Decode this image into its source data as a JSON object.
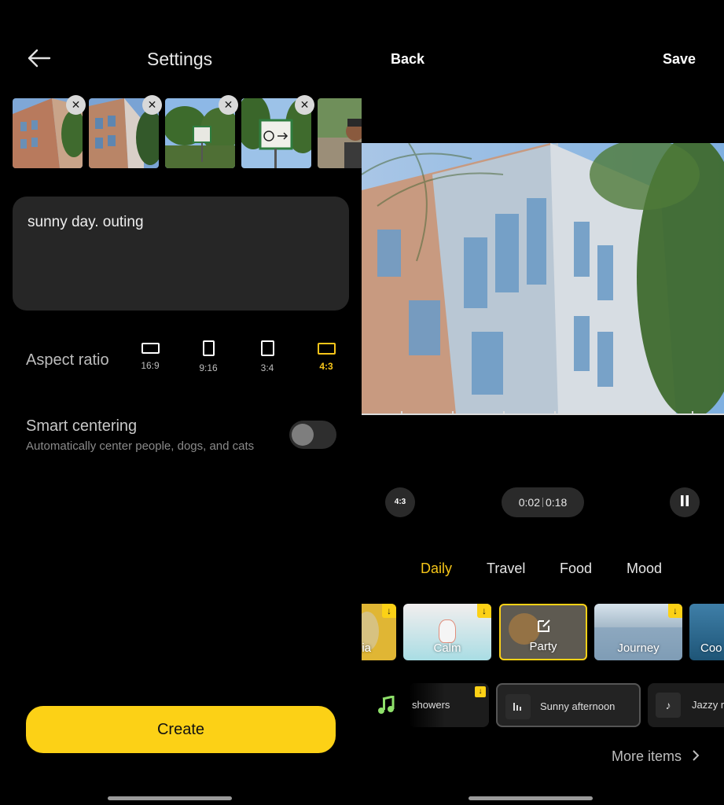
{
  "left": {
    "header": {
      "title": "Settings"
    },
    "thumbnails": [
      {
        "alt": "building photo 1"
      },
      {
        "alt": "building photo 2"
      },
      {
        "alt": "sign photo 1"
      },
      {
        "alt": "sign photo 2"
      },
      {
        "alt": "selfie photo"
      }
    ],
    "caption": {
      "text": "sunny day. outing"
    },
    "aspect_ratio": {
      "label": "Aspect ratio",
      "options": [
        {
          "label": "16:9",
          "selected": false
        },
        {
          "label": "9:16",
          "selected": false
        },
        {
          "label": "3:4",
          "selected": false
        },
        {
          "label": "4:3",
          "selected": true
        }
      ]
    },
    "smart_centering": {
      "title": "Smart centering",
      "description": "Automatically center people, dogs, and cats",
      "enabled": false
    },
    "create_label": "Create"
  },
  "right": {
    "header": {
      "back_label": "Back",
      "save_label": "Save"
    },
    "controls": {
      "aspect_badge": "4:3",
      "time_current": "0:02",
      "time_total": "0:18",
      "pause_icon": "pause-icon"
    },
    "categories": [
      {
        "label": "Daily",
        "selected": true
      },
      {
        "label": "Travel",
        "selected": false
      },
      {
        "label": "Food",
        "selected": false
      },
      {
        "label": "Mood",
        "selected": false
      }
    ],
    "styles": [
      {
        "name": "gia",
        "download": true
      },
      {
        "name": "Calm",
        "download": true
      },
      {
        "name": "Party",
        "selected": true
      },
      {
        "name": "Journey",
        "download": true
      },
      {
        "name": "Coo"
      }
    ],
    "music": [
      {
        "name": "showers",
        "download": true
      },
      {
        "name": "Sunny afternoon",
        "selected": true
      },
      {
        "name": "Jazzy r"
      }
    ],
    "more_items_label": "More items"
  },
  "colors": {
    "accent": "#fcd116",
    "selected_text": "#f5c518"
  }
}
